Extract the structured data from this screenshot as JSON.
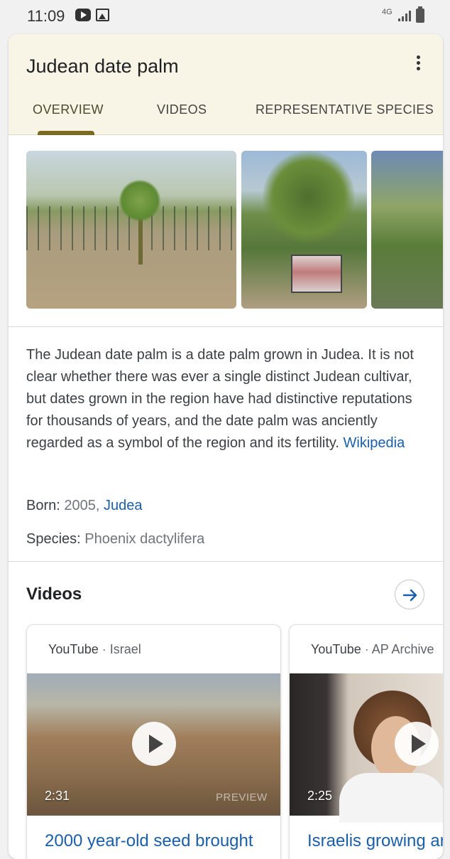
{
  "status_bar": {
    "time": "11:09",
    "net": "4G"
  },
  "panel": {
    "title": "Judean date palm",
    "tabs": [
      "OVERVIEW",
      "VIDEOS",
      "REPRESENTATIVE SPECIES"
    ],
    "active_tab": "OVERVIEW"
  },
  "description": {
    "text": "The Judean date palm is a date palm grown in Judea. It is not clear whether there was ever a single distinct Judean cultivar, but dates grown in the region have had distinctive reputations for thousands of years, and the date palm was anciently regarded as a symbol of the region and its fertility.",
    "source_link": "Wikipedia"
  },
  "facts": {
    "born_label": "Born:",
    "born_year": "2005,",
    "born_place": "Judea",
    "species_label": "Species:",
    "species_value": "Phoenix dactylifera"
  },
  "videos": {
    "heading": "Videos",
    "items": [
      {
        "source": "YouTube",
        "channel": "Israel",
        "duration": "2:31",
        "preview": "PREVIEW",
        "title": "2000 year-old seed brought"
      },
      {
        "source": "YouTube",
        "channel": "AP Archive",
        "duration": "2:25",
        "title": "Israelis growing ar"
      }
    ]
  },
  "icons": {
    "status": [
      "youtube-icon",
      "image-icon",
      "network-icon",
      "signal-icon",
      "battery-icon"
    ],
    "menu": "more-vert-icon",
    "videos_more": "arrow-right-icon",
    "play": "play-icon"
  },
  "colors": {
    "header_bg": "#f8f4e6",
    "tab_indicator": "#7a6a22",
    "link": "#1a5fa8"
  }
}
